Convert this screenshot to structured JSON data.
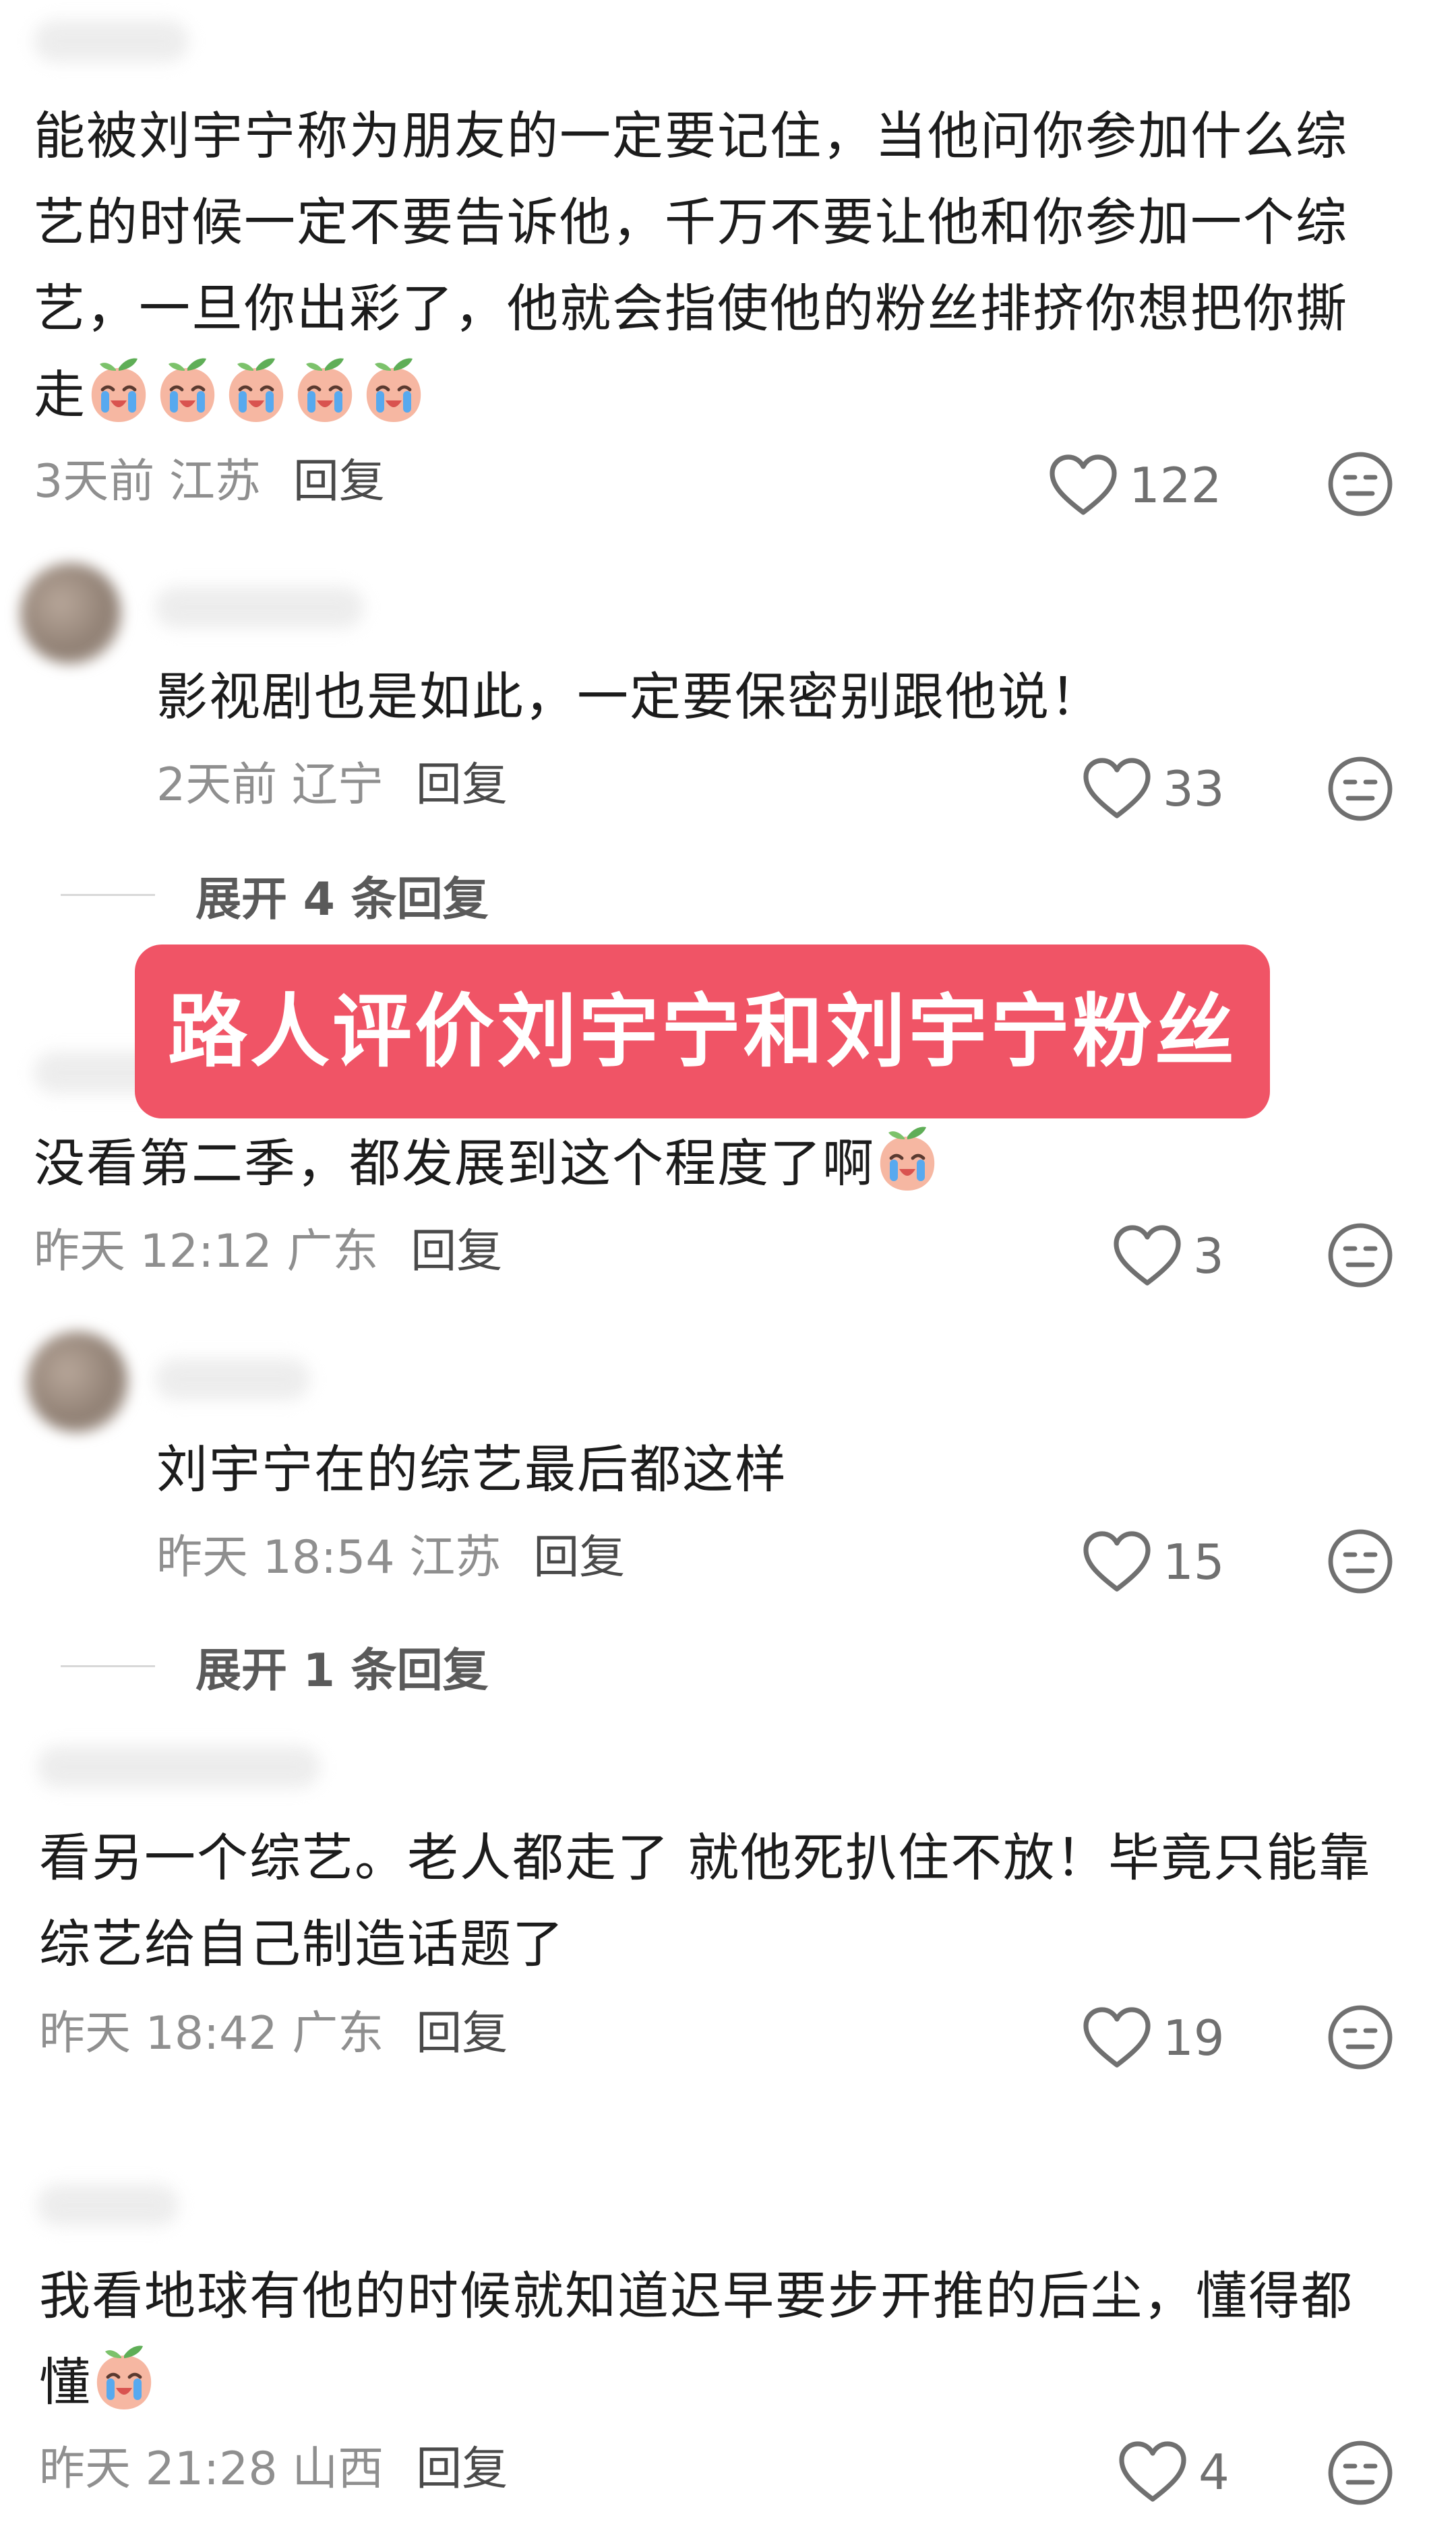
{
  "banner": {
    "title": "路人评价刘宇宁和刘宇宁粉丝"
  },
  "reply_label": "回复",
  "comments": [
    {
      "text": "能被刘宇宁称为朋友的一定要记住，当他问你参加什么综艺的时候一定不要告诉他，千万不要让他和你参加一个综艺，一旦你出彩了，他就会指使他的粉丝排挤你想把你撕走",
      "emoji_count": 5,
      "time": "3天前 江苏",
      "likes": "122",
      "replies": [
        {
          "text": "影视剧也是如此，一定要保密别跟他说！",
          "time": "2天前 辽宁",
          "likes": "33"
        }
      ],
      "expand": "展开 4 条回复"
    },
    {
      "text": "没看第二季，都发展到这个程度了啊",
      "emoji_count": 1,
      "time": "昨天 12:12 广东",
      "likes": "3",
      "replies": [
        {
          "text": "刘宇宁在的综艺最后都这样",
          "time": "昨天 18:54 江苏",
          "likes": "15"
        }
      ],
      "expand": "展开 1 条回复"
    },
    {
      "text": "看另一个综艺。老人都走了 就他死扒住不放！毕竟只能靠综艺给自己制造话题了",
      "emoji_count": 0,
      "time": "昨天 18:42 广东",
      "likes": "19"
    },
    {
      "text": "我看地球有他的时候就知道迟早要步开推的后尘，懂得都懂",
      "emoji_count": 1,
      "time": "昨天 21:28 山西",
      "likes": "4"
    }
  ],
  "icons": {
    "like": "heart-outline-icon",
    "dislike": "neutral-face-icon",
    "emoji": "crying-peach-emoji"
  }
}
